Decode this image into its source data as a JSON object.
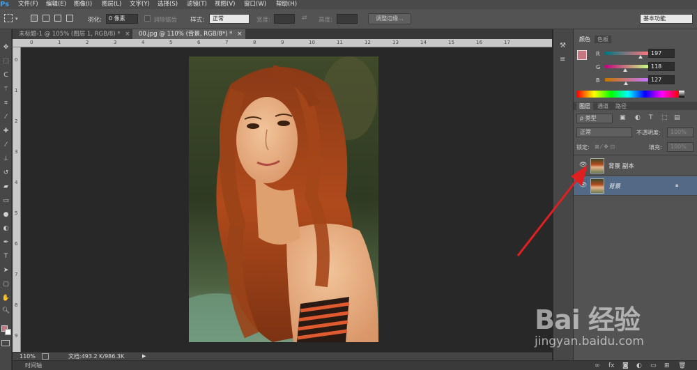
{
  "menubar": {
    "logo": "Ps",
    "items": [
      "文件(F)",
      "编辑(E)",
      "图像(I)",
      "图层(L)",
      "文字(Y)",
      "选择(S)",
      "滤镜(T)",
      "视图(V)",
      "窗口(W)",
      "帮助(H)"
    ]
  },
  "options": {
    "feather_label": "羽化:",
    "feather_value": "0 像素",
    "antialias_label": "消除锯齿",
    "style_label": "样式:",
    "style_value": "正常",
    "width_label": "宽度:",
    "height_label": "高度:",
    "refine_edge": "调整边缘...",
    "workspace": "基本功能"
  },
  "tabs": [
    {
      "label": "未标题-1 @ 105% (图层 1, RGB/8) *",
      "close": "×"
    },
    {
      "label": "00.jpg @ 110% (背景, RGB/8*) *",
      "close": "×"
    }
  ],
  "rulers": {
    "h": [
      "0",
      "1",
      "2",
      "3",
      "4",
      "5",
      "6",
      "7",
      "8",
      "9",
      "10",
      "11",
      "12",
      "13",
      "14",
      "15",
      "16",
      "17"
    ],
    "v": [
      "0",
      "1",
      "2",
      "3",
      "4",
      "5",
      "6",
      "7",
      "8",
      "9"
    ]
  },
  "status": {
    "zoom": "110%",
    "doc": "文档:493.2 K/986.3K",
    "timeline": "时间轴"
  },
  "color_panel": {
    "tab_color": "颜色",
    "tab_swatches": "色板",
    "r_label": "R",
    "g_label": "G",
    "b_label": "B",
    "r": "197",
    "g": "118",
    "b": "127",
    "foreground": "#c5767f",
    "background": "#ffffff"
  },
  "layers_panel": {
    "tab_layers": "图层",
    "tab_channels": "通道",
    "tab_paths": "路径",
    "filter_kind": "ρ 类型",
    "blend_mode": "正常",
    "opacity_label": "不透明度:",
    "opacity_value": "100%",
    "lock_label": "锁定:",
    "fill_label": "填充:",
    "fill_value": "100%",
    "layers": [
      {
        "name": "背景 副本",
        "selected": false
      },
      {
        "name": "背景",
        "selected": true
      }
    ]
  },
  "watermark": {
    "brand": "Bai 经验",
    "url": "jingyan.baidu.com"
  },
  "colors": {
    "accent_arrow": "#e02020",
    "selected_layer": "#536a87"
  }
}
